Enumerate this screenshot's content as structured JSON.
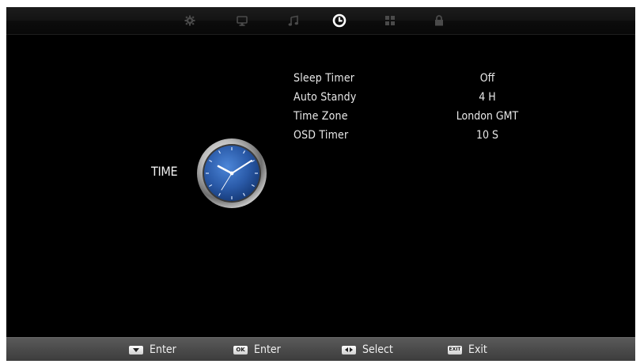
{
  "tabs": [
    {
      "icon": "gear-icon"
    },
    {
      "icon": "monitor-icon"
    },
    {
      "icon": "music-note-icon"
    },
    {
      "icon": "clock-icon",
      "active": true
    },
    {
      "icon": "grid-icon"
    },
    {
      "icon": "lock-icon"
    }
  ],
  "page": {
    "title": "TIME"
  },
  "menu": {
    "items": [
      {
        "label": "Sleep Timer",
        "value": "Off"
      },
      {
        "label": "Auto Standy",
        "value": "4 H"
      },
      {
        "label": "Time Zone",
        "value": "London GMT"
      },
      {
        "label": "OSD Timer",
        "value": "10 S"
      }
    ]
  },
  "footer": {
    "hints": [
      {
        "key": "down-key",
        "label": "Enter"
      },
      {
        "key": "OK",
        "label": "Enter"
      },
      {
        "key": "left-right-key",
        "label": "Select"
      },
      {
        "key": "EXIT",
        "label": "Exit"
      }
    ]
  },
  "colors": {
    "background": "#000000",
    "active_tab": "#ffffff",
    "inactive_tab": "#4a4a4a",
    "clock_face": "#2a5aa8",
    "footer_bar": "#4a4a4a"
  }
}
